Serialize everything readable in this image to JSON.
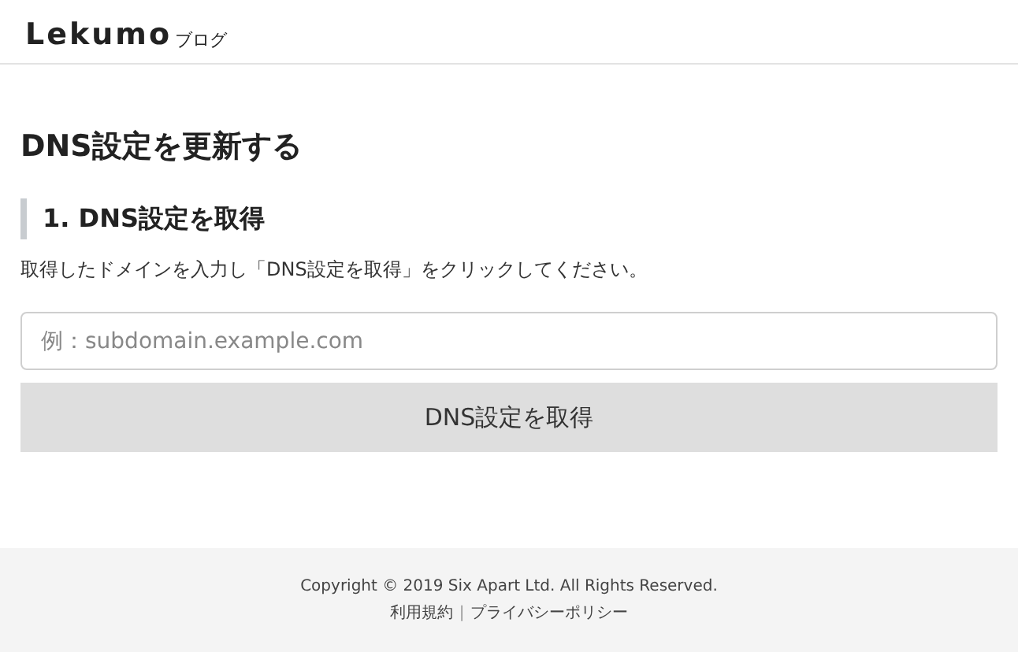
{
  "header": {
    "logo": "Lekumo",
    "logo_suffix": "ブログ"
  },
  "page_title": "DNS設定を更新する",
  "section": {
    "heading": "1. DNS設定を取得",
    "description": "取得したドメインを入力し「DNS設定を取得」をクリックしてください。",
    "input": {
      "placeholder": "例：subdomain.example.com"
    },
    "button": "DNS設定を取得"
  },
  "footer": {
    "copyright": "Copyright © 2019 Six Apart Ltd. All Rights Reserved.",
    "links": [
      "利用規約",
      "プライバシーポリシー"
    ],
    "separator": "|"
  }
}
